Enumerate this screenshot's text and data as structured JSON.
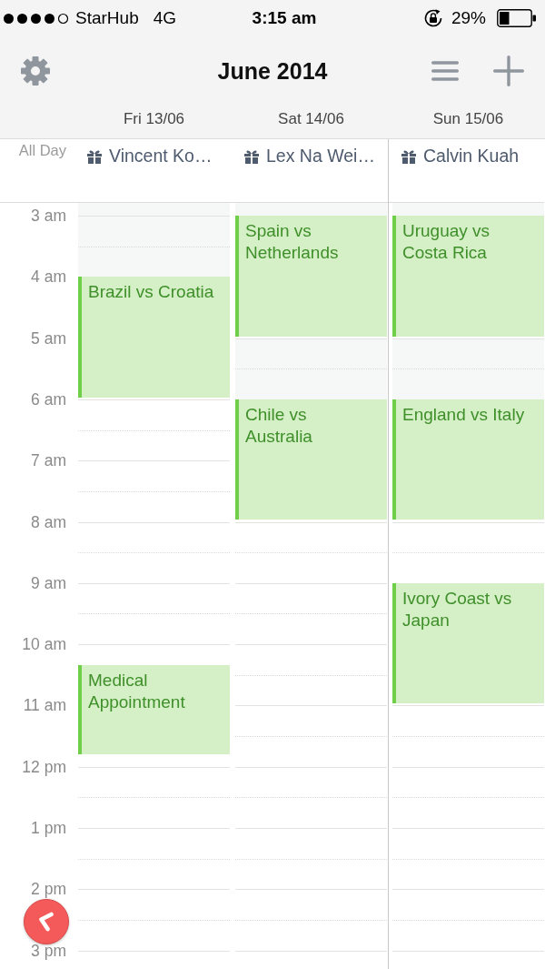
{
  "status_bar": {
    "carrier": "StarHub",
    "network": "4G",
    "time": "3:15 am",
    "battery": "29%"
  },
  "header": {
    "title": "June 2014"
  },
  "all_day_label": "All Day",
  "hours": [
    "3 am",
    "4 am",
    "5 am",
    "6 am",
    "7 am",
    "8 am",
    "9 am",
    "10 am",
    "11 am",
    "12 pm",
    "1 pm",
    "2 pm",
    "3 pm"
  ],
  "days": [
    {
      "label": "Fri 13/06",
      "all_day": [
        {
          "title": "Vincent Ko…"
        }
      ],
      "events": [
        {
          "title": "Brazil vs Croatia"
        },
        {
          "title": "Medical Appointment"
        }
      ]
    },
    {
      "label": "Sat 14/06",
      "all_day": [
        {
          "title": "Lex Na Wei…"
        }
      ],
      "events": [
        {
          "title": "Spain vs Netherlands"
        },
        {
          "title": "Chile vs Australia"
        }
      ]
    },
    {
      "label": "Sun 15/06",
      "all_day": [
        {
          "title": "Calvin Kuah"
        }
      ],
      "events": [
        {
          "title": "Uruguay vs Costa Rica"
        },
        {
          "title": "England vs Italy"
        },
        {
          "title": "Ivory Coast vs Japan"
        }
      ]
    }
  ]
}
